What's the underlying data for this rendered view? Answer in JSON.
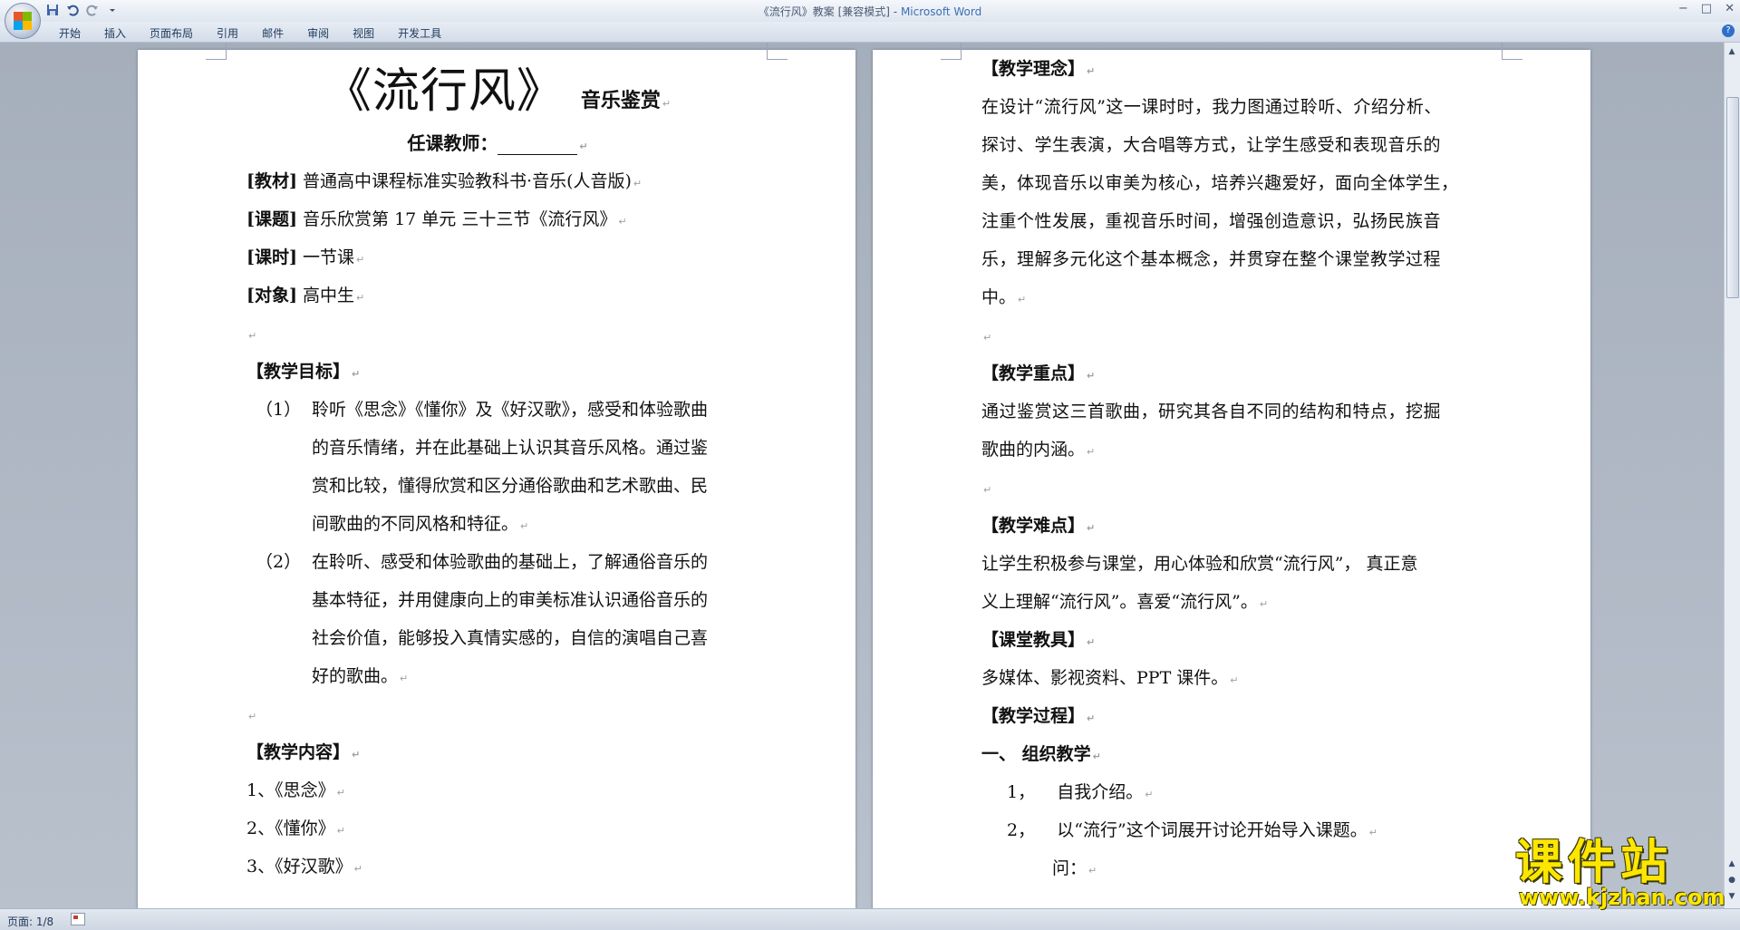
{
  "window": {
    "title_doc": "《流行风》教案 [兼容模式]",
    "title_sep": " - ",
    "title_app": "Microsoft Word",
    "minimize": "−",
    "maximize": "□",
    "close": "✕"
  },
  "quick_access": {
    "save_icon": "save-icon",
    "undo_icon": "undo-icon",
    "redo_icon": "redo-icon",
    "more_icon": "dropdown-icon"
  },
  "ribbon_tabs": [
    "开始",
    "插入",
    "页面布局",
    "引用",
    "邮件",
    "审阅",
    "视图",
    "开发工具"
  ],
  "help_label": "?",
  "left_page": {
    "title_big": "《流行风》",
    "title_sub": "音乐鉴赏",
    "teacher_label": "任课教师：",
    "meta": [
      {
        "label": "[教材]",
        "value": "普通高中课程标准实验教科书·音乐(人音版)"
      },
      {
        "label": "[课题]",
        "value": "音乐欣赏第 17 单元  三十三节《流行风》"
      },
      {
        "label": "[课时]",
        "value": "一节课"
      },
      {
        "label": "[对象]",
        "value": "高中生"
      }
    ],
    "goals_heading": "【教学目标】",
    "goals": [
      {
        "num": "（1）",
        "lines": [
          "聆听《思念》《懂你》及《好汉歌》，感受和体验歌曲",
          "的音乐情绪，并在此基础上认识其音乐风格。通过鉴",
          "赏和比较，懂得欣赏和区分通俗歌曲和艺术歌曲、民",
          "间歌曲的不同风格和特征。"
        ]
      },
      {
        "num": "（2）",
        "lines": [
          "在聆听、感受和体验歌曲的基础上，了解通俗音乐的",
          "基本特征，并用健康向上的审美标准认识通俗音乐的",
          "社会价值，能够投入真情实感的，自信的演唱自己喜",
          "好的歌曲。"
        ]
      }
    ],
    "content_heading": "【教学内容】",
    "content_items": [
      "1、《思念》",
      "2、《懂你》",
      "3、《好汉歌》"
    ]
  },
  "right_page": {
    "idea_heading": "【教学理念】",
    "idea_lines": [
      "在设计“流行风”这一课时时，我力图通过聆听、介绍分析、",
      "探讨、学生表演，大合唱等方式，让学生感受和表现音乐的",
      "美，体现音乐以审美为核心，培养兴趣爱好，面向全体学生，",
      "注重个性发展，重视音乐时间，增强创造意识，弘扬民族音",
      "乐，理解多元化这个基本概念，并贯穿在整个课堂教学过程",
      "中。"
    ],
    "key_heading": "【教学重点】",
    "key_lines": [
      "通过鉴赏这三首歌曲，研究其各自不同的结构和特点，挖掘",
      "歌曲的内涵。"
    ],
    "diff_heading": "【教学难点】",
    "diff_lines": [
      "让学生积极参与课堂，用心体验和欣赏“流行风”，  真正意",
      "义上理解“流行风”。喜爱“流行风”。"
    ],
    "tools_heading": "【课堂教具】",
    "tools_line": "多媒体、影视资料、PPT 课件。",
    "process_heading": "【教学过程】",
    "process_step1": "一、 组织教学",
    "process_items": [
      {
        "num": "1，",
        "text": "自我介绍。"
      },
      {
        "num": "2，",
        "text": "以“流行”这个词展开讨论开始导入课题。"
      }
    ],
    "question": "问："
  },
  "para_mark": "↵",
  "status": {
    "page": "页面: 1/8"
  },
  "watermark": {
    "top": "课件站",
    "bottom": "www.kjzhan.com"
  }
}
